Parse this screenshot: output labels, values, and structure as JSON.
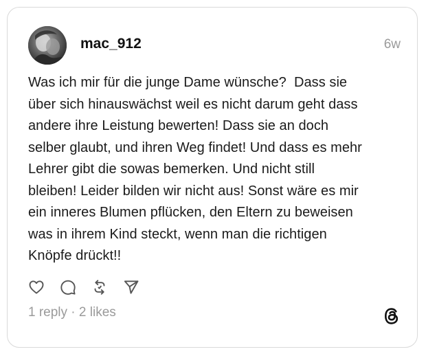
{
  "post": {
    "username": "mac_912",
    "timestamp": "6w",
    "text_lines": [
      "Was ich mir für die junge Dame wünsche?  Dass sie",
      "über sich hinauswächst weil es nicht darum geht dass",
      "andere ihre Leistung bewerten! Dass sie an doch",
      "selber glaubt, und ihren Weg findet! Und dass es mehr",
      "Lehrer gibt die sowas bemerken. Und nicht still",
      "bleiben! Leider bilden wir nicht aus! Sonst wäre es mir",
      "ein inneres Blumen pflücken, den Eltern zu beweisen",
      "was in ihrem Kind steckt, wenn man die richtigen",
      "Knöpfe drückt!!"
    ],
    "stats": "1 reply · 2 likes"
  },
  "actions": [
    {
      "name": "like",
      "icon": "heart-icon"
    },
    {
      "name": "reply",
      "icon": "comment-icon"
    },
    {
      "name": "repost",
      "icon": "repost-icon"
    },
    {
      "name": "share",
      "icon": "send-icon"
    }
  ],
  "colors": {
    "border": "#d9d9d9",
    "text": "#1a1a1a",
    "muted": "#9a9a9a",
    "icon": "#555555"
  },
  "branding": {
    "logo_icon": "threads-logo-icon"
  }
}
